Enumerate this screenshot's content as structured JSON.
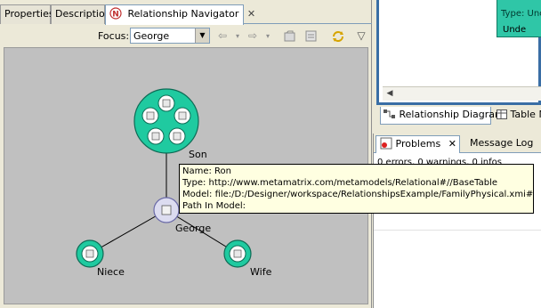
{
  "left_tabs": [
    {
      "label": "Properties"
    },
    {
      "label": "Description"
    },
    {
      "label": "Relationship Navigator",
      "close": "✕"
    }
  ],
  "toolbar": {
    "focus_label": "Focus:",
    "focus_value": "George",
    "dropdown_glyph": "▼",
    "back_glyph": "⇦",
    "menu_glyph": "▾",
    "forward_glyph": "⇨",
    "view_menu_glyph": "▽"
  },
  "graph": {
    "nodes": [
      {
        "id": "son",
        "label": "Son",
        "type": "group"
      },
      {
        "id": "george",
        "label": "George",
        "type": "focus"
      },
      {
        "id": "niece",
        "label": "Niece",
        "type": "single"
      },
      {
        "id": "wife",
        "label": "Wife",
        "type": "single"
      }
    ],
    "edges": [
      [
        "son",
        "george"
      ],
      [
        "george",
        "niece"
      ],
      [
        "george",
        "wife"
      ]
    ],
    "colors": {
      "node_fill": "#1fcaa0",
      "node_stroke": "#0e6b55",
      "focus_fill": "#dcdcf0",
      "focus_stroke": "#6a6aa8",
      "edge": "#000000"
    }
  },
  "tooltip": {
    "name": "Name: Ron",
    "type": "Type: http://www.metamatrix.com/metamodels/Relational#//BaseTable",
    "model": "Model: file:/D:/Designer/workspace/RelationshipsExample/FamilyPhysical.xmi#mmu",
    "path": "Path In Model:"
  },
  "diagram": {
    "partial_top": "Unc",
    "partial_type": "Type: Unc",
    "partial_item": "Unde",
    "scroll_left": "◀",
    "tabs": [
      {
        "label": "Relationship Diagram"
      },
      {
        "label": "Table M"
      }
    ]
  },
  "problems": {
    "tabs": [
      {
        "label": "Problems",
        "close": "✕"
      },
      {
        "label": "Message Log"
      }
    ],
    "summary": "0 errors, 0 warnings, 0 infos"
  }
}
